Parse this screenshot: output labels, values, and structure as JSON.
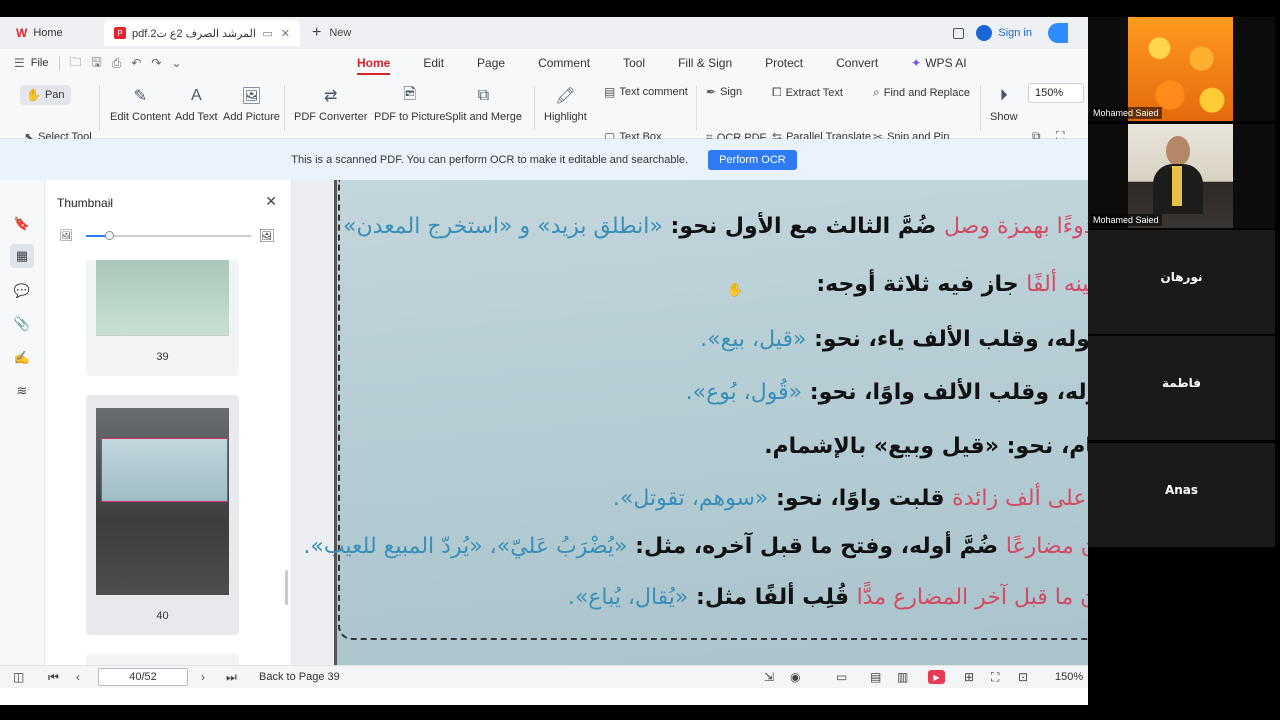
{
  "tabs": {
    "home_label": "Home",
    "doc_label": "المرشد الصرف 2ع ت2.pdf",
    "new_label": "New"
  },
  "account": {
    "signin_label": "Sign in"
  },
  "menu": {
    "file_label": "File",
    "tabs": [
      "Home",
      "Edit",
      "Page",
      "Comment",
      "Tool",
      "Fill & Sign",
      "Protect",
      "Convert",
      "WPS AI"
    ],
    "active_tab": "Home"
  },
  "ribbon": {
    "pan": "Pan",
    "select_tool": "Select Tool",
    "edit_content": "Edit Content",
    "add_text": "Add Text",
    "add_picture": "Add Picture",
    "pdf_converter": "PDF Converter",
    "pdf_to_picture": "PDF to Picture",
    "split_merge": "Split and Merge",
    "highlight": "Highlight",
    "text_comment": "Text comment",
    "text_box": "Text Box",
    "sign": "Sign",
    "ocr_pdf": "OCR PDF",
    "extract_text": "Extract Text",
    "parallel_translate": "Parallel Translate",
    "find_replace": "Find and Replace",
    "snip_pin": "Snip and Pin",
    "show": "Show",
    "zoom_value": "150%"
  },
  "ocr_banner": {
    "message": "This is a scanned PDF. You can perform OCR to make it editable and searchable.",
    "button": "Perform OCR"
  },
  "thumbnail_panel": {
    "title": "Thumbnail",
    "pages": [
      "39",
      "40"
    ]
  },
  "document": {
    "lines": [
      {
        "black": "ضُمَّ الثالث مع الأول نحو:",
        "red": "كان مبدوءًا بهمزة وصل",
        "blue": "«انطلق بزيد» و «استخرج المعدن»"
      },
      {
        "black": "جاز فيه ثلاثة أوجه:",
        "red": "كانت عينه ألفًا",
        "blue": ""
      },
      {
        "black": "كسر أوله، وقلب الألف ياء، نحو:",
        "red": "",
        "blue": "«قيل، بيع»."
      },
      {
        "black": "ضم أوله، وقلب الألف واوًا، نحو:",
        "red": "",
        "blue": "«قُول، بُوع»."
      },
      {
        "black": "الإشمام، نحو: «قيل وبيع» بالإشمام.",
        "red": "",
        "blue": ""
      },
      {
        "black": "قلبت واوًا، نحو:",
        "red": "اشتمل على ألف زائدة",
        "blue": "«سوهم، تقوتل»."
      },
      {
        "black": "ضُمَّ أوله، وفتح ما قبل آخره، مثل:",
        "red": "وإن كان مضارعًا",
        "blue": "«يُضْرَبُ عَليّ»، «يُردّ المبيع للعيب»."
      },
      {
        "black": "قُلِب ألفًا مثل:",
        "red": "فإن كان ما قبل آخر المضارع مدًّا",
        "blue": "«يُقال، يُباع»."
      }
    ]
  },
  "statusbar": {
    "page_input": "40/52",
    "back_to": "Back to Page 39",
    "zoom": "150%"
  },
  "participants": [
    {
      "name": "Mohamed Saied",
      "kind": "video-flowers"
    },
    {
      "name": "Mohamed Saied",
      "kind": "video-speaker"
    },
    {
      "name": "نورهان",
      "kind": "name-only"
    },
    {
      "name": "فاطمة",
      "kind": "name-only"
    },
    {
      "name": "Anas",
      "kind": "name-only"
    }
  ],
  "colors": {
    "accent_red": "#d3242e",
    "ocr_blue": "#2f7bf5",
    "banner_bg": "#eaf2fd",
    "page_bg": "#b7ced5",
    "arabic_red": "#d14b63",
    "arabic_blue": "#3a8fb8"
  }
}
